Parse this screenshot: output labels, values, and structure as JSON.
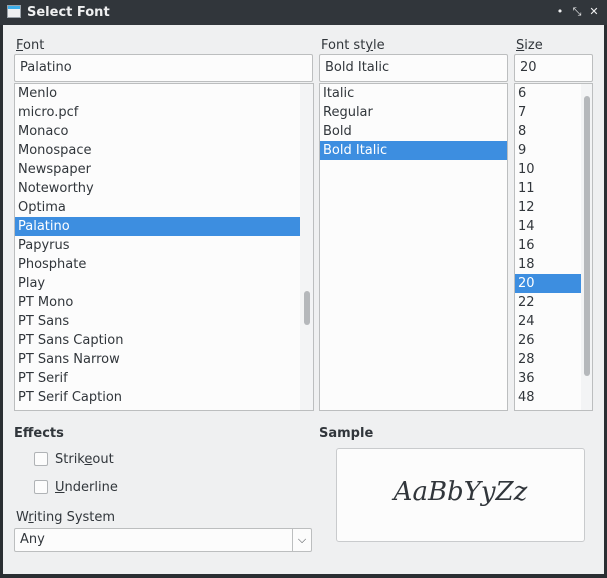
{
  "window": {
    "title": "Select Font",
    "controls": {
      "minimize": "•",
      "maximize": "⤡",
      "close": "✕"
    }
  },
  "font": {
    "label": "Font",
    "value": "Palatino",
    "items": [
      "Menlo",
      "micro.pcf",
      "Monaco",
      "Monospace",
      "Newspaper",
      "Noteworthy",
      "Optima",
      "Palatino",
      "Papyrus",
      "Phosphate",
      "Play",
      "PT Mono",
      "PT Sans",
      "PT Sans Caption",
      "PT Sans Narrow",
      "PT Serif",
      "PT Serif Caption"
    ],
    "selected": "Palatino"
  },
  "style": {
    "label": "Font style",
    "value": "Bold Italic",
    "items": [
      "Italic",
      "Regular",
      "Bold",
      "Bold Italic"
    ],
    "selected": "Bold Italic"
  },
  "size": {
    "label": "Size",
    "value": "20",
    "items": [
      "6",
      "7",
      "8",
      "9",
      "10",
      "11",
      "12",
      "14",
      "16",
      "18",
      "20",
      "22",
      "24",
      "26",
      "28",
      "36",
      "48"
    ],
    "selected": "20"
  },
  "effects": {
    "title": "Effects",
    "strikeout": "Strikeout",
    "underline": "Underline",
    "strikeout_checked": false,
    "underline_checked": false
  },
  "writing_system": {
    "label": "Writing System",
    "value": "Any"
  },
  "sample": {
    "title": "Sample",
    "text": "AaBbYyZz"
  },
  "colors": {
    "selection": "#3d8ee0",
    "titlebar": "#31363b",
    "dialog": "#eff0f1"
  }
}
